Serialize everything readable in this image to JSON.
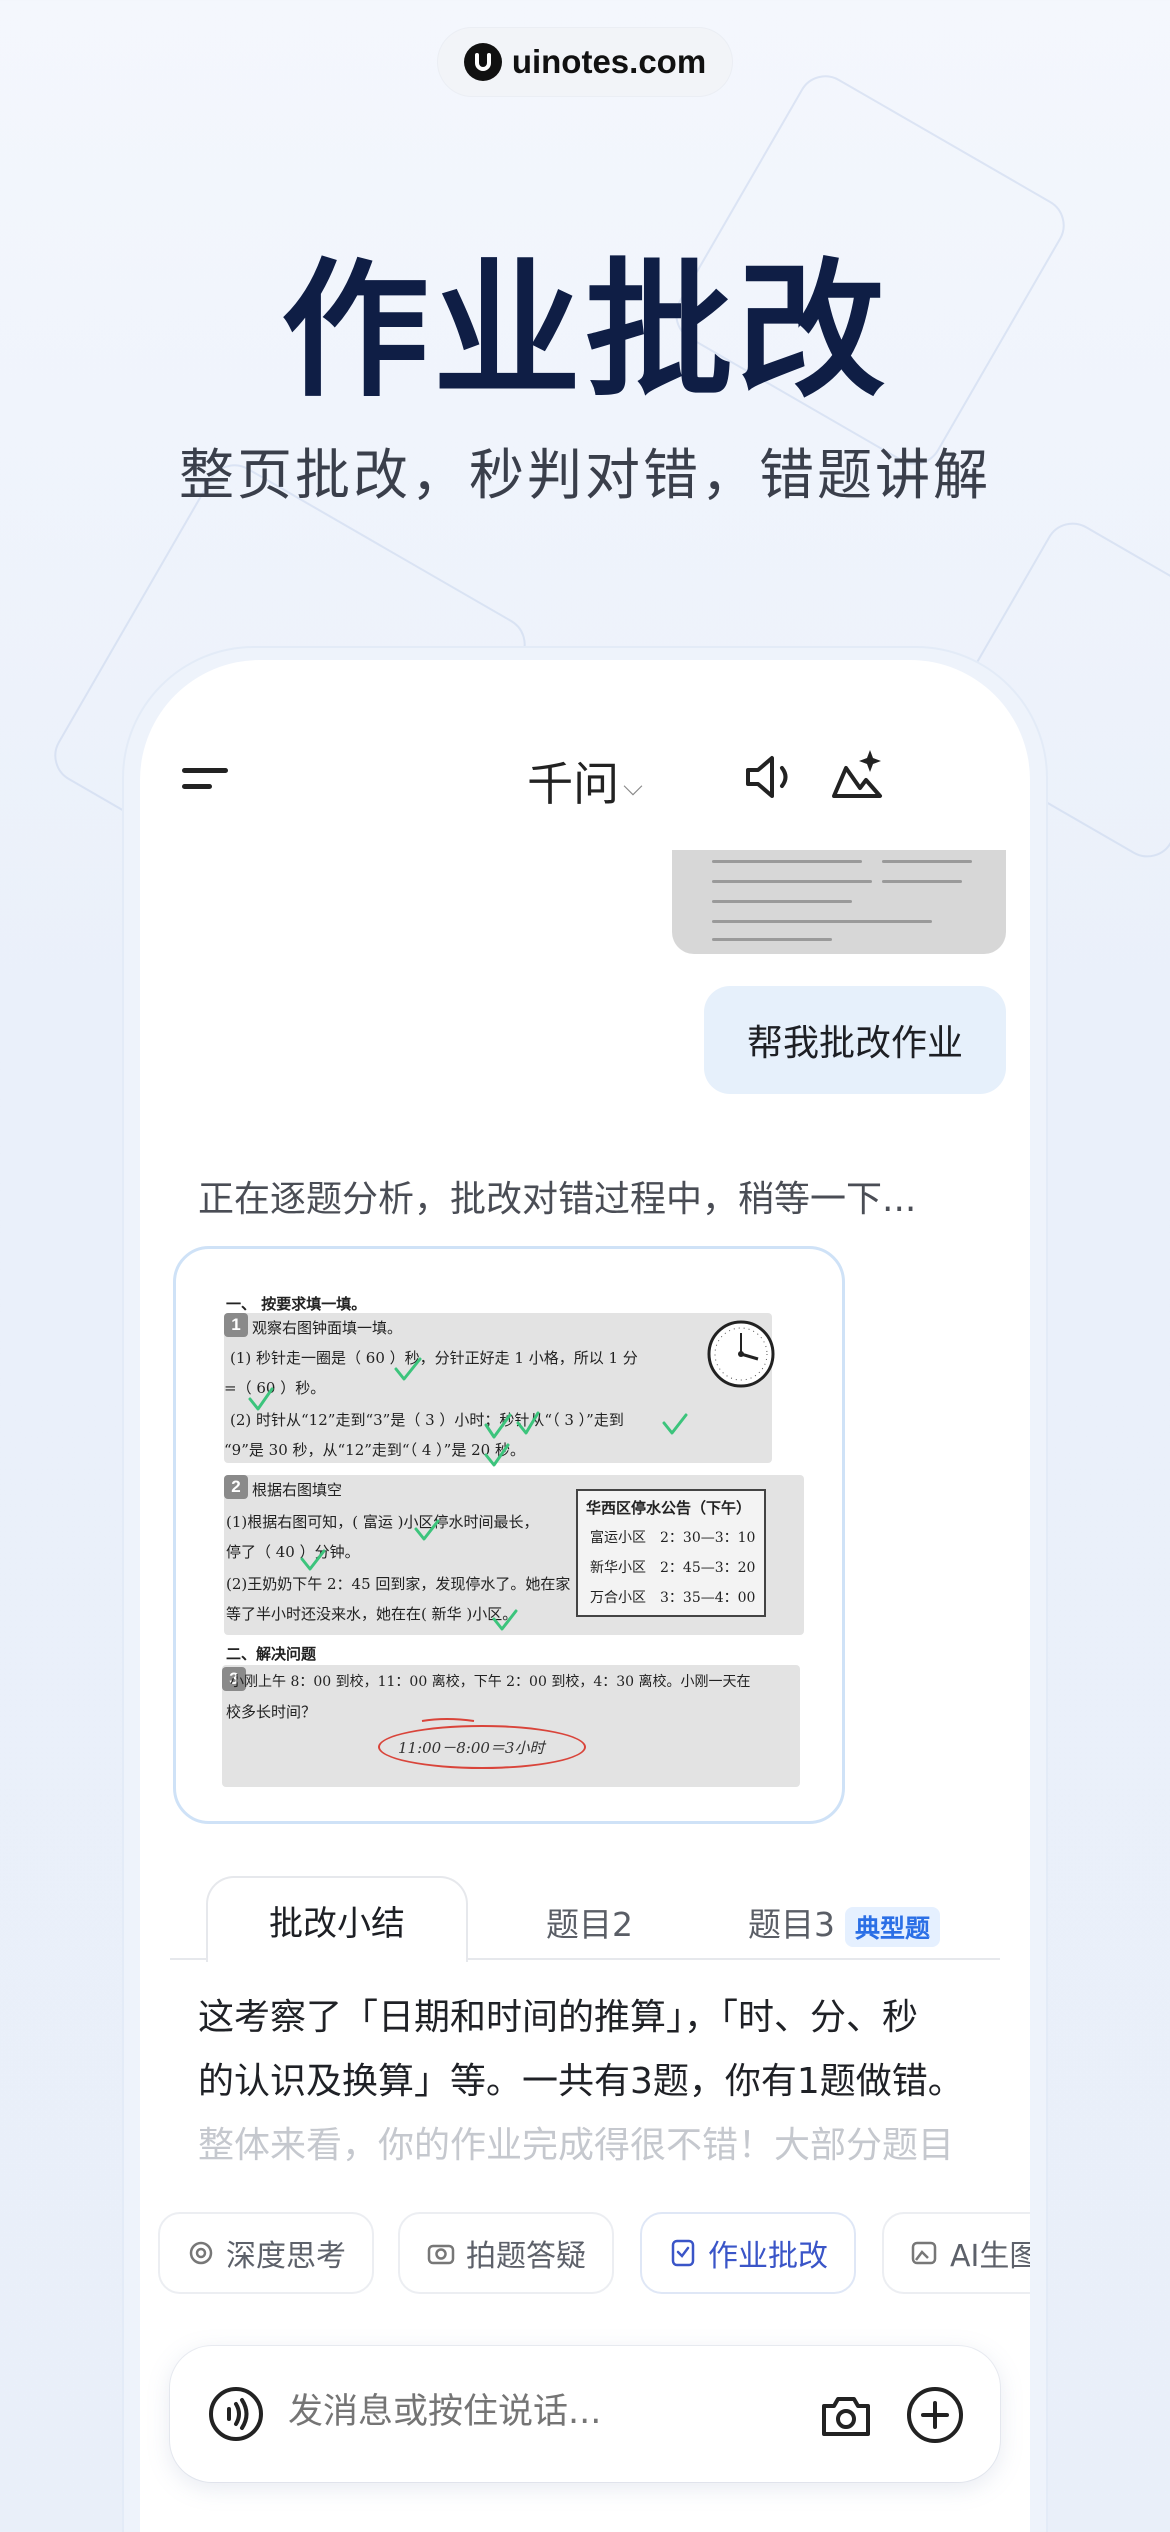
{
  "watermark": {
    "site": "uinotes.com"
  },
  "hero": {
    "title": "作业批改",
    "subtitle": "整页批改，秒判对错，错题讲解"
  },
  "nav": {
    "title": "千问",
    "chevron": "⌵",
    "icons": [
      "menu-icon",
      "speaker-icon",
      "sparkle-icon"
    ]
  },
  "chat": {
    "user_message": "帮我批改作业",
    "assistant_status": "正在逐题分析，批改对错过程中，稍等一下..."
  },
  "homework": {
    "section1_title": "一、 按要求填一填。",
    "q1_title": "观察右图钟面填一填。",
    "q1_line1": "(1) 秒针走一圈是（ 60 ）秒，分针正好走 1 小格，所以 1 分",
    "q1_line2": "=（ 60 ）秒。",
    "q1_line3": "(2) 时针从“12”走到“3”是（ 3 ）小时；秒针从“（ 3 ）”走到",
    "q1_line4": "“9”是 30 秒，从“12”走到“（ 4 ）”是 20 秒。",
    "q2_title": "根据右图填空",
    "q2_line1": "(1)根据右图可知，( 富运 )小区停水时间最长，",
    "q2_line2": "停了（ 40 ）分钟。",
    "q2_line3": "(2)王奶奶下午 2：45 回到家，发现停水了。她在家",
    "q2_line4": "等了半小时还没来水，她在在( 新华 )小区。",
    "notice_title": "华西区停水公告（下午）",
    "notice_rows": [
      "富运小区　2：30—3：10",
      "新华小区　2：45—3：20",
      "万合小区　3：35—4：00"
    ],
    "section2_title": "二、解决问题",
    "q3_line1": "小刚上午 8：00 到校，11：00 离校，下午 2：00 到校，4：30 离校。小刚一天在",
    "q3_line2": "校多长时间？",
    "q3_answer": "11:00－8:00＝3小时",
    "num1": "1",
    "num2": "2",
    "num3": "3"
  },
  "tabs": {
    "active": "批改小结",
    "tab2": "题目2",
    "tab3": "题目3",
    "tab3_tag": "典型题"
  },
  "summary": {
    "line1": "这考察了「日期和时间的推算」，「时、分、秒",
    "line2": "的认识及换算」等。一共有3题，你有1题做错。",
    "line3": "整体来看，你的作业完成得很不错！大部分题目"
  },
  "chips": [
    {
      "label": "深度思考",
      "icon": "brain-icon"
    },
    {
      "label": "拍题答疑",
      "icon": "camera-question-icon"
    },
    {
      "label": "作业批改",
      "icon": "homework-check-icon"
    },
    {
      "label": "AI生图",
      "icon": "image-gen-icon"
    }
  ],
  "input": {
    "placeholder": "发消息或按住说话..."
  },
  "colors": {
    "hero_title": "#0f1e45",
    "accent_blue": "#3a55c8",
    "user_bubble": "#e6f0fb",
    "tag_bg": "#e5f0ff",
    "tag_text": "#2b6fe6",
    "check_green": "#3cc47c",
    "answer_red": "#d9443a"
  }
}
